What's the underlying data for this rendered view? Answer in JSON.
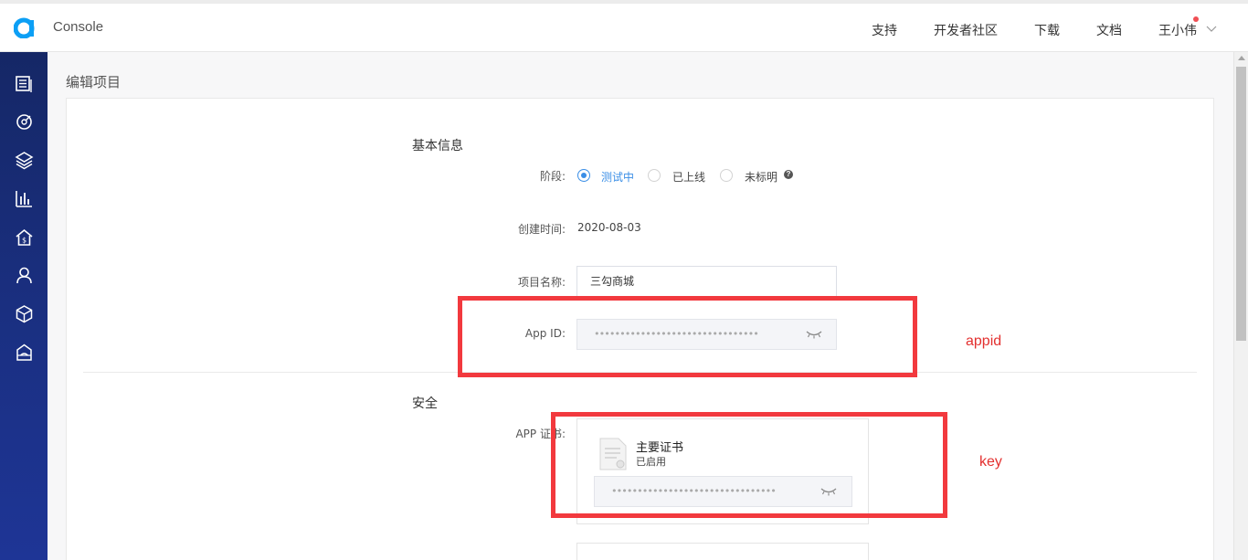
{
  "header": {
    "brand": "Console",
    "nav": [
      {
        "label": "支持"
      },
      {
        "label": "开发者社区"
      },
      {
        "label": "下载"
      },
      {
        "label": "文档"
      }
    ],
    "user": "王小伟"
  },
  "sidebar": {
    "icons": [
      "document-list-icon",
      "target-icon",
      "layers-icon",
      "bar-chart-icon",
      "home-dollar-icon",
      "user-icon",
      "cube-icon",
      "box-icon"
    ]
  },
  "page": {
    "title": "编辑项目"
  },
  "basic": {
    "section_title": "基本信息",
    "stage_label": "阶段:",
    "stage_options": [
      {
        "label": "测试中",
        "selected": true
      },
      {
        "label": "已上线",
        "selected": false
      },
      {
        "label": "未标明",
        "selected": false
      }
    ],
    "created_label": "创建时间:",
    "created_value": "2020-08-03",
    "name_label": "项目名称:",
    "name_value": "三勾商城",
    "appid_label": "App ID:",
    "appid_value": "••••••••••••••••••••••••••••••••"
  },
  "security": {
    "section_title": "安全",
    "cert_label": "APP 证书:",
    "cert_title": "主要证书",
    "cert_status": "已启用",
    "cert_value": "••••••••••••••••••••••••••••••••"
  },
  "annotations": {
    "appid": "appid",
    "key": "key",
    "color": "#f2393e"
  },
  "colors": {
    "accent": "#3a8ee6",
    "sidebar": "#1a2f80"
  }
}
